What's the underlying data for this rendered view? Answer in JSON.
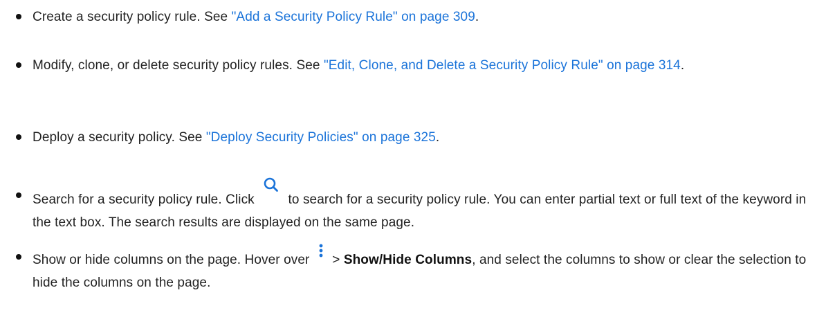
{
  "bullets": [
    {
      "text": "Create a security policy rule. See ",
      "link": "\"Add a Security Policy Rule\" on page 309",
      "suffix": "."
    },
    {
      "text": "Modify, clone, or delete security policy rules. See ",
      "link": "\"Edit, Clone, and Delete a Security Policy Rule\" on page 314",
      "suffix": "."
    },
    {
      "text": "Deploy a security policy. See ",
      "link": "\"Deploy Security Policies\" on page 325",
      "suffix": "."
    },
    {
      "text_before_icon": "Search for a security policy rule. Click ",
      "icon": "search-icon",
      "text_after_icon": " to search for a security policy rule. You can enter partial text or full text of the keyword in the text box. The search results are displayed on the same page."
    },
    {
      "text_before_icon": "Show or hide columns on the page. Hover over ",
      "icon": "vertical-ellipsis-icon",
      "separator": " > ",
      "bold": "Show/Hide Columns",
      "text_after": ", and select the columns to show or clear the selection to hide the columns on the page."
    }
  ],
  "colors": {
    "link": "#1a73d9",
    "icon": "#1a73d9",
    "text": "#222222"
  }
}
